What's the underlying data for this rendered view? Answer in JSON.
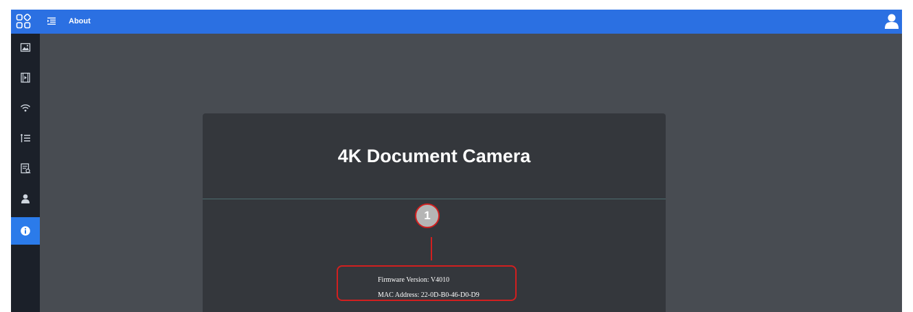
{
  "header": {
    "title": "About",
    "apps_icon": "apps-grid-icon",
    "menu_icon": "menu-list-icon",
    "user_icon": "user-icon"
  },
  "sidebar": {
    "items": [
      {
        "icon": "image-icon",
        "active": false
      },
      {
        "icon": "video-icon",
        "active": false
      },
      {
        "icon": "wifi-icon",
        "active": false
      },
      {
        "icon": "list-icon",
        "active": false
      },
      {
        "icon": "log-icon",
        "active": false
      },
      {
        "icon": "user-icon",
        "active": false
      },
      {
        "icon": "info-icon",
        "active": true
      }
    ]
  },
  "card": {
    "title": "4K Document Camera",
    "callout_number": "1",
    "firmware_label": "Firmware Version: ",
    "firmware_value": "V4010",
    "mac_label": "MAC Address: ",
    "mac_value": "22-0D-B0-46-D0-D9"
  },
  "colors": {
    "topbar": "#2b70e2",
    "sidebar": "#1b2029",
    "active_item": "#2b7bea",
    "content_bg": "#484c52",
    "card_bg": "#34373c",
    "callout_red": "#d31f1f"
  }
}
